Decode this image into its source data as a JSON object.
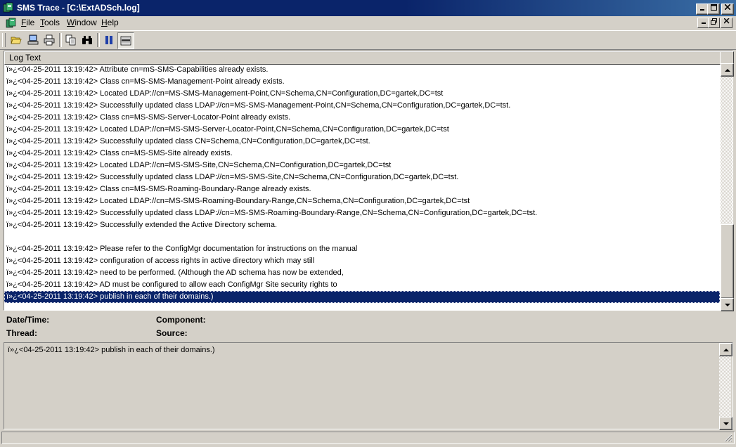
{
  "window": {
    "title": "SMS Trace - [C:\\ExtADSch.log]",
    "caption_buttons": [
      "minimize",
      "maximize",
      "close"
    ]
  },
  "menu": {
    "items": [
      "File",
      "Tools",
      "Window",
      "Help"
    ],
    "mnemonics": [
      "F",
      "T",
      "W",
      "H"
    ]
  },
  "toolbar": {
    "buttons": [
      "open-icon",
      "open-on-server-icon",
      "print-icon",
      "copy-icon",
      "find-icon",
      "pause-icon",
      "highlight-icon"
    ]
  },
  "log_list": {
    "column_header": "Log Text",
    "selected_index": 19,
    "rows": [
      "ï»¿<04-25-2011 13:19:42> Attribute cn=mS-SMS-Capabilities already exists.",
      "ï»¿<04-25-2011 13:19:42> Class cn=MS-SMS-Management-Point already exists.",
      "ï»¿<04-25-2011 13:19:42> Located LDAP://cn=MS-SMS-Management-Point,CN=Schema,CN=Configuration,DC=gartek,DC=tst",
      "ï»¿<04-25-2011 13:19:42> Successfully updated class LDAP://cn=MS-SMS-Management-Point,CN=Schema,CN=Configuration,DC=gartek,DC=tst.",
      "ï»¿<04-25-2011 13:19:42> Class cn=MS-SMS-Server-Locator-Point already exists.",
      "ï»¿<04-25-2011 13:19:42> Located LDAP://cn=MS-SMS-Server-Locator-Point,CN=Schema,CN=Configuration,DC=gartek,DC=tst",
      "ï»¿<04-25-2011 13:19:42> Successfully updated class CN=Schema,CN=Configuration,DC=gartek,DC=tst.",
      "ï»¿<04-25-2011 13:19:42> Class cn=MS-SMS-Site already exists.",
      "ï»¿<04-25-2011 13:19:42> Located LDAP://cn=MS-SMS-Site,CN=Schema,CN=Configuration,DC=gartek,DC=tst",
      "ï»¿<04-25-2011 13:19:42> Successfully updated class LDAP://cn=MS-SMS-Site,CN=Schema,CN=Configuration,DC=gartek,DC=tst.",
      "ï»¿<04-25-2011 13:19:42> Class cn=MS-SMS-Roaming-Boundary-Range already exists.",
      "ï»¿<04-25-2011 13:19:42> Located LDAP://cn=MS-SMS-Roaming-Boundary-Range,CN=Schema,CN=Configuration,DC=gartek,DC=tst",
      "ï»¿<04-25-2011 13:19:42> Successfully updated class LDAP://cn=MS-SMS-Roaming-Boundary-Range,CN=Schema,CN=Configuration,DC=gartek,DC=tst.",
      "ï»¿<04-25-2011 13:19:42> Successfully extended the Active Directory schema.",
      "",
      "ï»¿<04-25-2011 13:19:42> Please refer to the ConfigMgr documentation for instructions on the manual",
      "ï»¿<04-25-2011 13:19:42> configuration of access rights in active directory which may still",
      "ï»¿<04-25-2011 13:19:42> need to be performed.  (Although the AD schema has now be extended,",
      "ï»¿<04-25-2011 13:19:42> AD must be configured to allow each ConfigMgr Site security rights to",
      "ï»¿<04-25-2011 13:19:42> publish in each of their domains.)"
    ]
  },
  "details": {
    "datetime_label": "Date/Time:",
    "datetime_value": "",
    "component_label": "Component:",
    "component_value": "",
    "thread_label": "Thread:",
    "thread_value": "",
    "source_label": "Source:",
    "source_value": "",
    "text": "ï»¿<04-25-2011 13:19:42> publish in each of their domains.)"
  },
  "status_bar": {
    "text": ""
  },
  "colors": {
    "titlebar": "#0a246a",
    "selection": "#0a246a",
    "face": "#d4d0c8"
  }
}
